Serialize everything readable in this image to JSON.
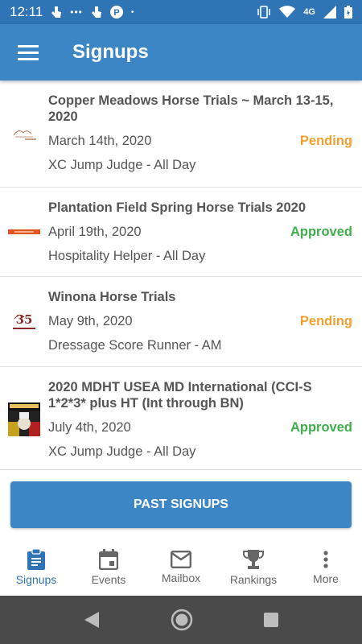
{
  "status_bar": {
    "time": "12:11",
    "network": "4G"
  },
  "app_bar": {
    "title": "Signups"
  },
  "signups": [
    {
      "title": "Copper Meadows Horse Trials ~ March 13-15, 2020",
      "date": "March 14th, 2020",
      "status": "Pending",
      "role": "XC Jump Judge - All Day",
      "logo": "copper-meadows"
    },
    {
      "title": "Plantation Field Spring Horse Trials 2020",
      "date": "April 19th, 2020",
      "status": "Approved",
      "role": "Hospitality Helper - All Day",
      "logo": "plantation-field"
    },
    {
      "title": "Winona Horse Trials",
      "date": "May 9th, 2020",
      "status": "Pending",
      "role": "Dressage Score Runner - AM",
      "logo": "winona"
    },
    {
      "title": "2020 MDHT USEA MD International (CCI-S 1*2*3* plus HT (Int through BN)",
      "date": "July 4th, 2020",
      "status": "Approved",
      "role": "XC Jump Judge - All Day",
      "logo": "maryland"
    }
  ],
  "past_signups_label": "PAST SIGNUPS",
  "bottom_nav": [
    {
      "label": "Signups",
      "icon": "clipboard-icon"
    },
    {
      "label": "Events",
      "icon": "calendar-icon"
    },
    {
      "label": "Mailbox",
      "icon": "mail-icon"
    },
    {
      "label": "Rankings",
      "icon": "trophy-icon"
    },
    {
      "label": "More",
      "icon": "more-vert-icon"
    }
  ],
  "colors": {
    "primary": "#3d86c6",
    "status_bar": "#2f74b5",
    "pending": "#f0a030",
    "approved": "#3fae4a"
  }
}
